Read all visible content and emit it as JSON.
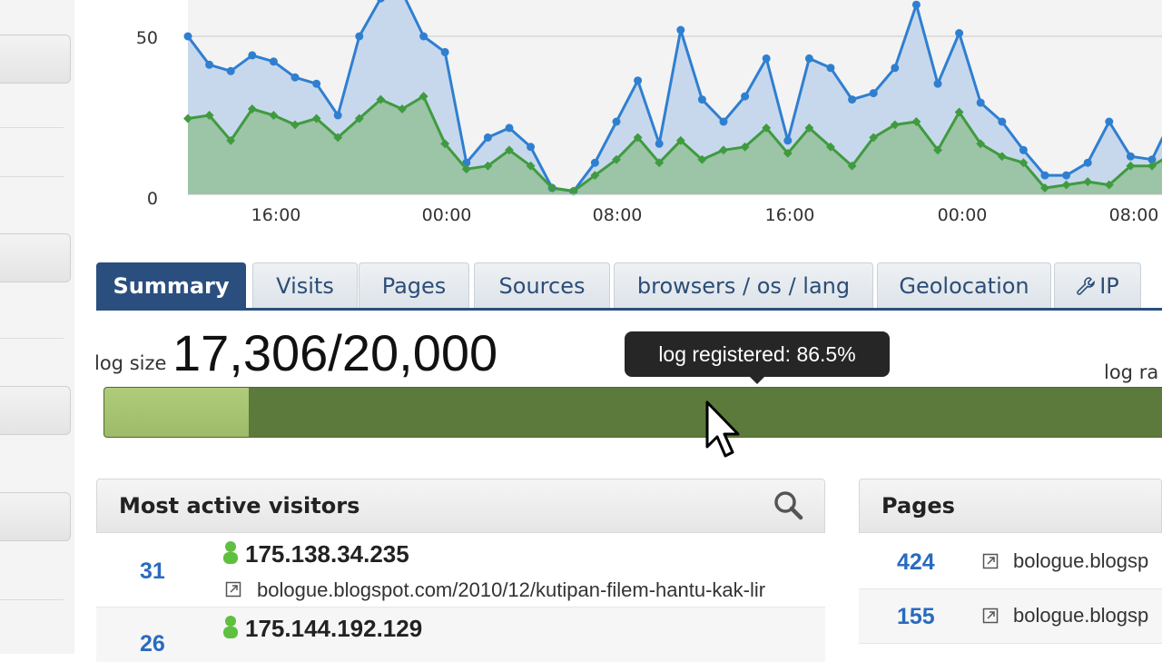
{
  "chart_data": {
    "type": "area",
    "x_ticks": [
      "16:00",
      "00:00",
      "08:00",
      "16:00",
      "00:00",
      "08:00"
    ],
    "y_ticks": [
      "50",
      "0"
    ],
    "ylim": [
      0,
      50
    ],
    "grid": true,
    "series": [
      {
        "color": "#2f7fd1",
        "fill": "#c8d8ec",
        "values": [
          50,
          41,
          39,
          44,
          42,
          37,
          35,
          25,
          50,
          62,
          64,
          50,
          45,
          10,
          18,
          21,
          15,
          2,
          1,
          10,
          23,
          36,
          16,
          52,
          30,
          23,
          31,
          43,
          17,
          43,
          40,
          30,
          32,
          40,
          60,
          35,
          51,
          29,
          23,
          14,
          6,
          6,
          10,
          23,
          12,
          11,
          25
        ]
      },
      {
        "color": "#3f9b3f",
        "fill": "#9cc4a6",
        "values": [
          24,
          25,
          17,
          27,
          25,
          22,
          24,
          18,
          24,
          30,
          27,
          31,
          16,
          8,
          9,
          14,
          9,
          2,
          1,
          6,
          11,
          18,
          10,
          17,
          11,
          14,
          15,
          21,
          13,
          21,
          15,
          9,
          18,
          22,
          23,
          14,
          26,
          16,
          12,
          10,
          2,
          3,
          4,
          3,
          9,
          9,
          13
        ]
      }
    ]
  },
  "tabs": [
    {
      "label": "Summary",
      "active": true
    },
    {
      "label": "Visits"
    },
    {
      "label": "Pages"
    },
    {
      "label": "Sources"
    },
    {
      "label": "browsers / os / lang"
    },
    {
      "label": "Geolocation"
    },
    {
      "label": "IP",
      "icon": "wrench-icon"
    }
  ],
  "log": {
    "size_label": "log size",
    "size_value": "17,306/20,000",
    "registered_fraction": 0.865,
    "tooltip": "log registered: 86.5%",
    "right_label": "log ra"
  },
  "visitors": {
    "title": "Most active visitors",
    "rows": [
      {
        "count": "31",
        "ip": "175.138.34.235",
        "url": "bologue.blogspot.com/2010/12/kutipan-filem-hantu-kak-lir"
      },
      {
        "count": "26",
        "ip": "175.144.192.129",
        "url": ""
      }
    ]
  },
  "pages": {
    "title": "Pages",
    "rows": [
      {
        "count": "424",
        "url": "bologue.blogsp"
      },
      {
        "count": "155",
        "url": "bologue.blogsp"
      }
    ]
  },
  "colors": {
    "accent": "#2a4f7f",
    "link": "#2a6bbf",
    "bar_dark": "#5c7a3c",
    "bar_light": "#9dbb68"
  }
}
